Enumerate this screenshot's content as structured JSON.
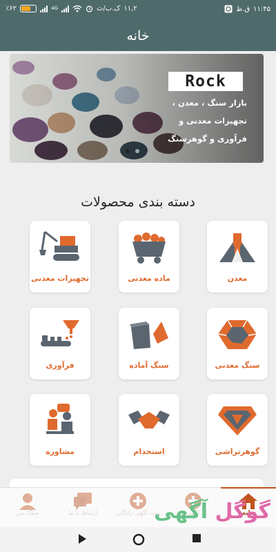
{
  "status_bar": {
    "time": "۱۱:۴۵",
    "day_marker": "ق.ظ",
    "speed_value": "۱۱,۲",
    "speed_unit": "ک.ب/ث",
    "network_tag": "4G",
    "battery_percent": "٪۶۲"
  },
  "app_bar": {
    "title": "خانه"
  },
  "banner": {
    "logo_text": "Rock",
    "lines": [
      "بازار سنگ ، معدن ،",
      "تجهیزات معدنی و",
      "فرآوری و گوهرسنگ"
    ],
    "slide_count": 2,
    "active_slide": 1
  },
  "section": {
    "title": "دسته بندی محصولات"
  },
  "categories": [
    {
      "label": "معدن",
      "icon": "mine-icon"
    },
    {
      "label": "ماده معدنی",
      "icon": "mine-cart-icon"
    },
    {
      "label": "تجهیزات معدنی",
      "icon": "excavator-icon"
    },
    {
      "label": "سنگ معدنی",
      "icon": "ore-stone-icon"
    },
    {
      "label": "سنگ آماده",
      "icon": "cut-stone-icon"
    },
    {
      "label": "فرآوری",
      "icon": "processing-funnel-icon"
    },
    {
      "label": "گوهرتراشی",
      "icon": "gem-icon"
    },
    {
      "label": "استخدام",
      "icon": "handshake-icon"
    },
    {
      "label": "مشاوره",
      "icon": "consultation-icon"
    }
  ],
  "bottom_nav": [
    {
      "label": "خانه",
      "icon": "home-icon",
      "active": true
    },
    {
      "label": "آگهی",
      "icon": "plus-circle-icon",
      "active": false
    },
    {
      "label": "ثبت آگهی رایگان",
      "icon": "plus-circle-icon",
      "active": false
    },
    {
      "label": "ارتباط با ما",
      "icon": "chat-icon",
      "active": false
    },
    {
      "label": "سنگ من",
      "icon": "user-icon",
      "active": false
    }
  ],
  "watermark": {
    "part1": "گوگل",
    "part2": "آگهی"
  },
  "system_nav": {
    "back": "back-icon",
    "home": "home-circle-icon",
    "recents": "recents-icon"
  },
  "colors": {
    "header": "#4f6a6b",
    "accent": "#e06a2e",
    "icon_gray": "#5a6570",
    "background": "#eeeeee"
  }
}
